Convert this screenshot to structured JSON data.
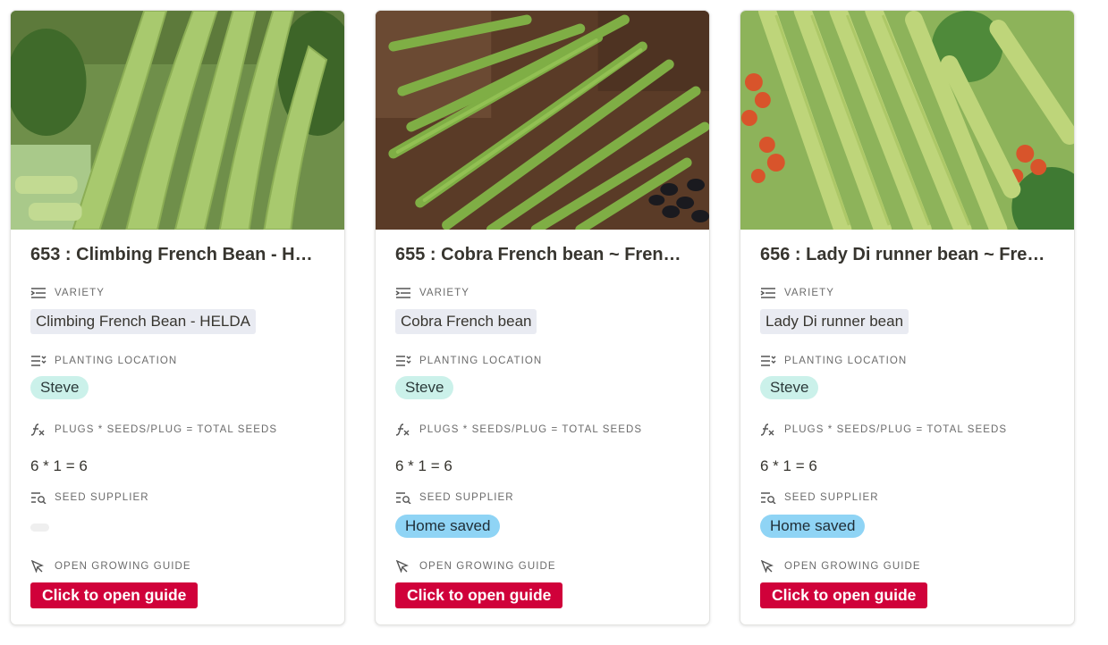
{
  "labels": {
    "variety": "VARIETY",
    "planting_location": "PLANTING LOCATION",
    "formula": "PLUGS * SEEDS/PLUG = TOTAL SEEDS",
    "seed_supplier": "SEED SUPPLIER",
    "growing_guide": "OPEN GROWING GUIDE"
  },
  "colors": {
    "guide_button": "#d0013a",
    "location_tag": "#cbf1ea",
    "supplier_tag": "#8fd4f5",
    "variety_tag": "#e9ebf2"
  },
  "cards": [
    {
      "title": "653 : Climbing French Bean - H…",
      "variety": "Climbing French Bean - HELDA",
      "location": "Steve",
      "formula_result": "6 * 1 = 6",
      "supplier": "",
      "button": "Click to open guide"
    },
    {
      "title": "655 : Cobra French bean ~ Fren…",
      "variety": "Cobra French bean",
      "location": "Steve",
      "formula_result": "6 * 1 = 6",
      "supplier": "Home saved",
      "button": "Click to open guide"
    },
    {
      "title": "656 : Lady Di runner bean ~ Fre…",
      "variety": "Lady Di runner bean",
      "location": "Steve",
      "formula_result": "6 * 1 = 6",
      "supplier": "Home saved",
      "button": "Click to open guide"
    }
  ],
  "icons": [
    "variety-icon",
    "planting-location-icon",
    "formula-icon",
    "seed-supplier-icon",
    "cursor-icon"
  ]
}
